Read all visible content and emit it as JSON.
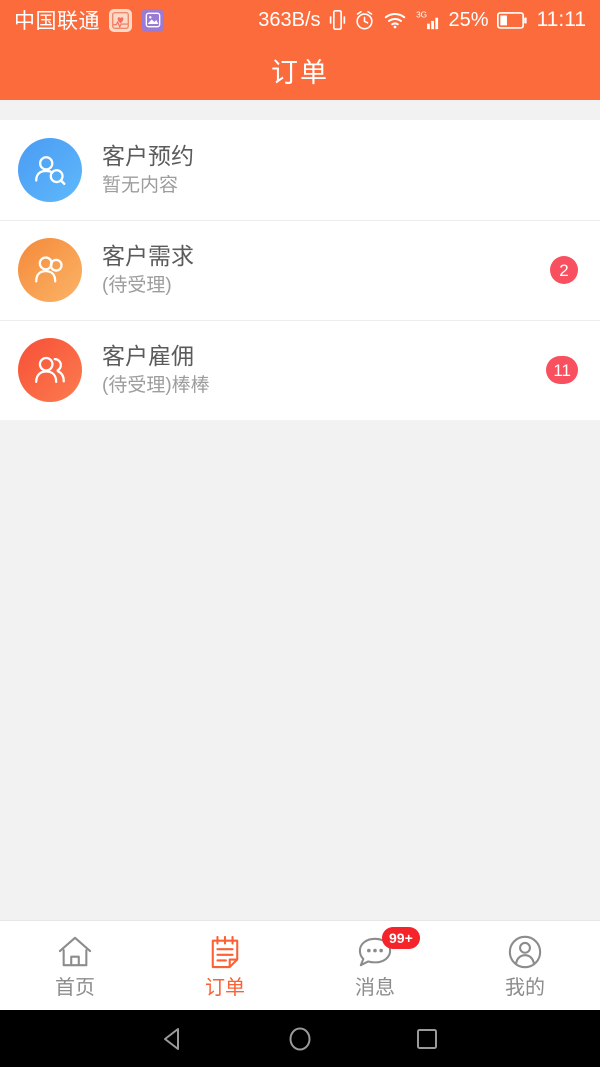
{
  "statusbar": {
    "carrier": "中国联通",
    "app_icons": [
      {
        "name": "health-app-icon",
        "color": "#fdd9c8"
      },
      {
        "name": "photo-app-icon",
        "color": "#9b7ad6"
      }
    ],
    "network_speed": "363B/s",
    "icons": [
      "vibrate-icon",
      "alarm-icon",
      "wifi-icon",
      "signal-3g-icon"
    ],
    "network_type": "3G",
    "battery_percent": "25%",
    "time": "11:11"
  },
  "header": {
    "title": "订单",
    "background": "#fb6b3c"
  },
  "list": {
    "rows": [
      {
        "title": "客户预约",
        "subtitle": "暂无内容",
        "badge": "",
        "avatar_icon": "person-search-icon",
        "avatar_color": "#4a9bf3"
      },
      {
        "title": "客户需求",
        "subtitle": "(待受理)",
        "badge": "2",
        "avatar_icon": "two-persons-icon",
        "avatar_color": "#f4893a"
      },
      {
        "title": "客户雇佣",
        "subtitle": "(待受理)棒棒",
        "badge": "11",
        "avatar_icon": "two-persons-icon",
        "avatar_color": "#f74f36"
      }
    ]
  },
  "tabbar": {
    "accent": "#fb6133",
    "tabs": [
      {
        "label": "首页",
        "icon": "home-icon",
        "badge": "",
        "active": false
      },
      {
        "label": "订单",
        "icon": "clipboard-icon",
        "badge": "",
        "active": true
      },
      {
        "label": "消息",
        "icon": "chat-bubble-icon",
        "badge": "99+",
        "active": false
      },
      {
        "label": "我的",
        "icon": "person-circle-icon",
        "badge": "",
        "active": false
      }
    ]
  },
  "navbar": {
    "buttons": [
      {
        "name": "back-button",
        "icon": "triangle-left-icon"
      },
      {
        "name": "home-button",
        "icon": "circle-icon"
      },
      {
        "name": "recents-button",
        "icon": "square-icon"
      }
    ]
  }
}
